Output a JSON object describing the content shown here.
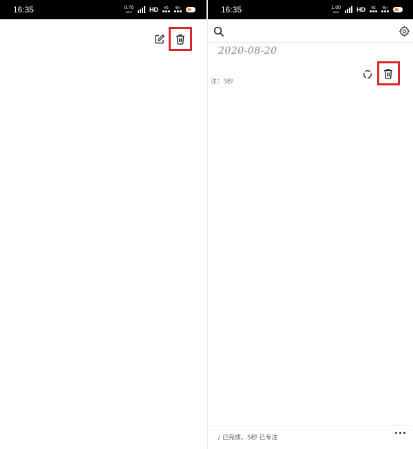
{
  "left_screen": {
    "status_bar": {
      "time": "16:35",
      "net_speed": "0.76",
      "net_unit": "KB/S",
      "hd": "HD",
      "network": "4G",
      "signal": "46+"
    },
    "toolbar": {
      "icons": [
        "edit-icon",
        "trash-icon"
      ]
    }
  },
  "right_screen": {
    "status_bar": {
      "time": "16:35",
      "net_speed": "1.00",
      "net_unit": "KB/S",
      "hd": "HD",
      "network": "4G",
      "signal": "46+"
    },
    "header": {
      "icons": [
        "search-icon",
        "gear-icon"
      ]
    },
    "date": "2020-08-20",
    "note": "注：3秒",
    "row_icons": [
      "loading-icon",
      "trash-icon"
    ],
    "footer": {
      "summary": "/ 已完成，5秒 已专注",
      "icons": [
        "more-icon"
      ]
    }
  },
  "colors": {
    "highlight": "#d9252b",
    "status_bg": "#000000",
    "divider": "#ececec"
  }
}
